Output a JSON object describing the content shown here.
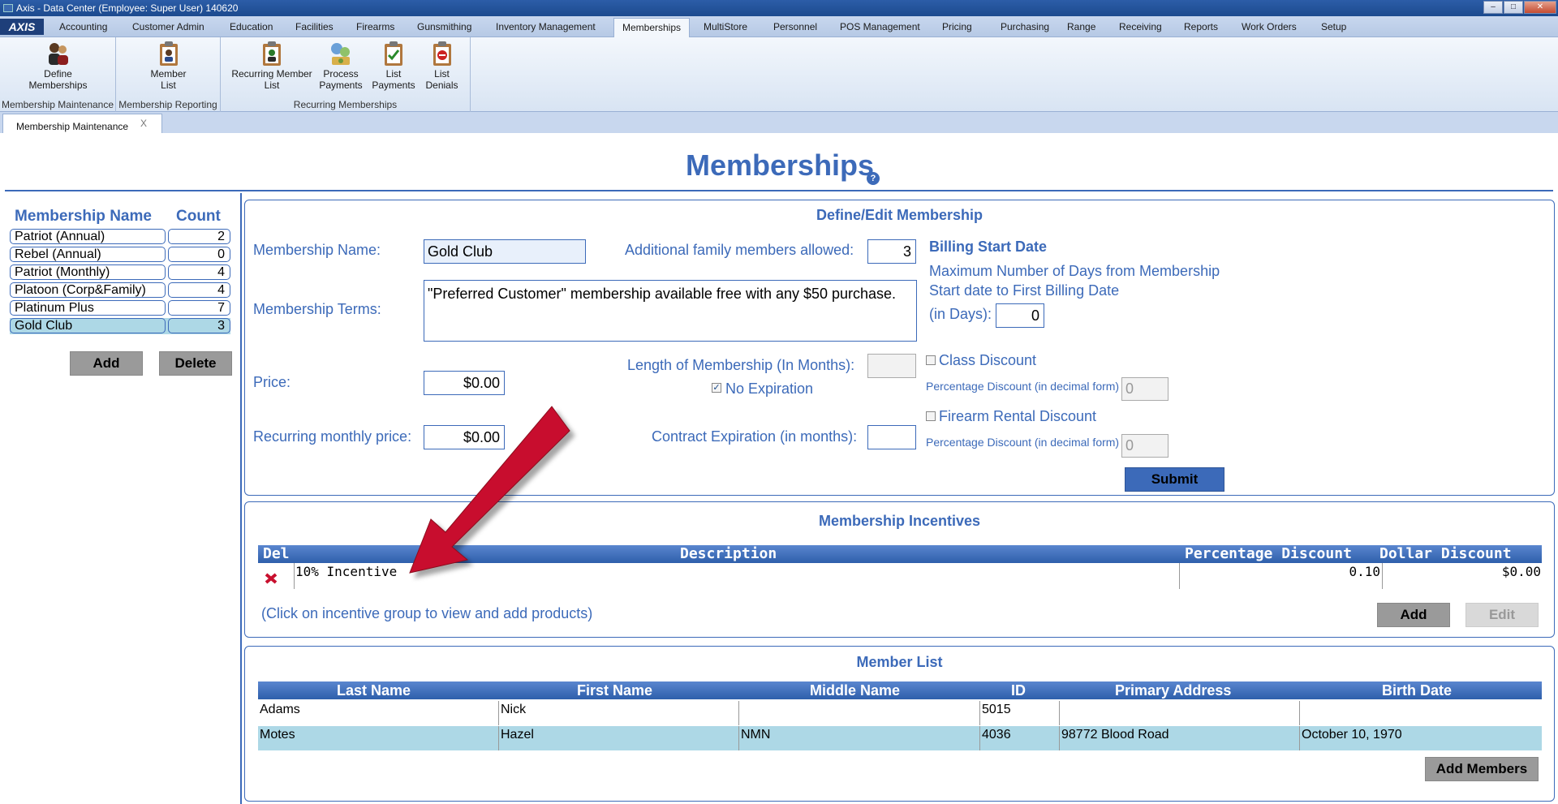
{
  "window": {
    "title": "Axis - Data Center  (Employee: Super User) 140620"
  },
  "menubar": {
    "logo": "AXIS",
    "items": [
      "Accounting",
      "Customer Admin",
      "Education",
      "Facilities",
      "Firearms",
      "Gunsmithing",
      "Inventory Management",
      "Memberships",
      "MultiStore",
      "Personnel",
      "POS Management",
      "Pricing",
      "Purchasing",
      "Range",
      "Receiving",
      "Reports",
      "Work Orders",
      "Setup"
    ],
    "active": "Memberships"
  },
  "ribbon": {
    "groups": [
      {
        "label": "Membership Maintenance",
        "buttons": [
          {
            "line1": "Define",
            "line2": "Memberships",
            "icon": "people-icon"
          }
        ]
      },
      {
        "label": "Membership Reporting",
        "buttons": [
          {
            "line1": "Member",
            "line2": "List",
            "icon": "clipboard-person-icon"
          }
        ]
      },
      {
        "label": "Recurring Memberships",
        "buttons": [
          {
            "line1": "Recurring Member",
            "line2": "List",
            "icon": "clipboard-person-icon"
          },
          {
            "line1": "Process",
            "line2": "Payments",
            "icon": "payments-icon"
          },
          {
            "line1": "List",
            "line2": "Payments",
            "icon": "clipboard-check-icon"
          },
          {
            "line1": "List",
            "line2": "Denials",
            "icon": "clipboard-deny-icon"
          }
        ]
      }
    ]
  },
  "tabs": {
    "doc_tab": "Membership Maintenance",
    "close": "X"
  },
  "page": {
    "title": "Memberships",
    "help": "?"
  },
  "membership_list": {
    "header_name": "Membership Name",
    "header_count": "Count",
    "rows": [
      {
        "name": "Patriot (Annual)",
        "count": "2"
      },
      {
        "name": "Rebel (Annual)",
        "count": "0"
      },
      {
        "name": "Patriot (Monthly)",
        "count": "4"
      },
      {
        "name": "Platoon (Corp&Family)",
        "count": "4"
      },
      {
        "name": "Platinum Plus",
        "count": "7"
      },
      {
        "name": "Gold Club",
        "count": "3"
      }
    ],
    "selected": "Gold Club",
    "add_label": "Add",
    "delete_label": "Delete"
  },
  "define": {
    "title": "Define/Edit Membership",
    "name_label": "Membership Name:",
    "name_value": "Gold Club",
    "family_label": "Additional family members allowed:",
    "family_value": "3",
    "billing_title": "Billing Start Date",
    "billing_line1": "Maximum Number of Days from Membership",
    "billing_line2": "Start date to First Billing Date",
    "billing_line3": "(in Days):",
    "billing_value": "0",
    "terms_label": "Membership Terms:",
    "terms_value": "\"Preferred Customer\" membership available free with any $50 purchase.",
    "price_label": "Price:",
    "price_value": "$0.00",
    "length_label": "Length of Membership (In Months):",
    "length_value": "",
    "no_expiration_label": "No Expiration",
    "no_expiration_checked": true,
    "class_discount_label": "Class Discount",
    "class_pct_label": "Percentage Discount (in decimal form)",
    "class_pct_value": "0",
    "firearm_discount_label": "Firearm Rental Discount",
    "firearm_pct_label": "Percentage Discount (in decimal form)",
    "firearm_pct_value": "0",
    "recurring_label": "Recurring monthly price:",
    "recurring_value": "$0.00",
    "contract_label": "Contract Expiration (in months):",
    "contract_value": "",
    "submit_label": "Submit"
  },
  "incentives": {
    "title": "Membership Incentives",
    "headers": {
      "del": "Del",
      "description": "Description",
      "pct": "Percentage Discount",
      "dollar": "Dollar Discount"
    },
    "rows": [
      {
        "description": "10% Incentive",
        "pct": "0.10",
        "dollar": "$0.00"
      }
    ],
    "hint": "(Click on incentive group to view and add products)",
    "add_label": "Add",
    "edit_label": "Edit"
  },
  "members": {
    "title": "Member List",
    "headers": [
      "Last Name",
      "First Name",
      "Middle Name",
      "ID",
      "Primary Address",
      "Birth Date"
    ],
    "rows": [
      [
        "Adams",
        "Nick",
        "",
        "5015",
        "",
        ""
      ],
      [
        "Motes",
        "Hazel",
        "NMN",
        "4036",
        "98772 Blood Road",
        "October 10, 1970"
      ]
    ],
    "add_members_label": "Add Members"
  },
  "colors": {
    "accent": "#3c6ab9",
    "selected_row": "#add8e6",
    "annotation_arrow": "#c8102e"
  }
}
